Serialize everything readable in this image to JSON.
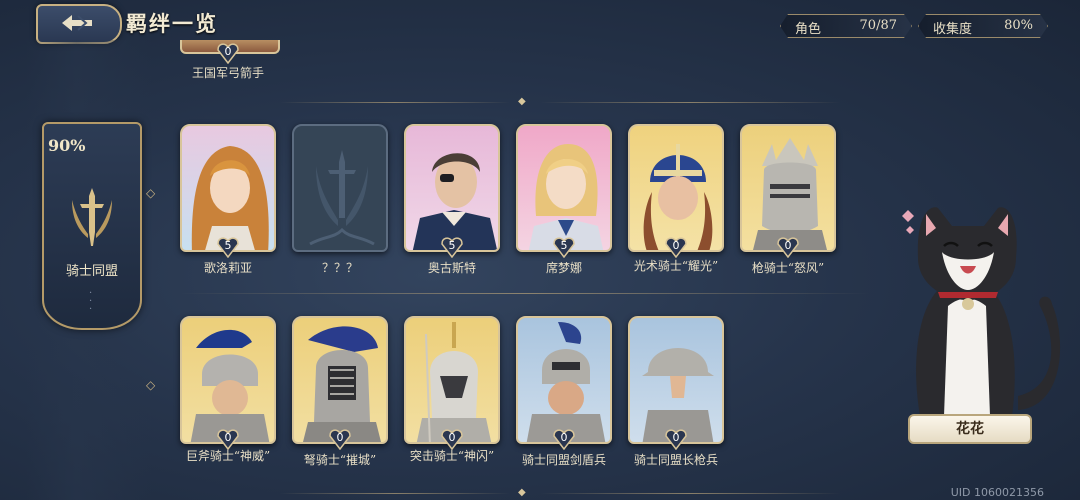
{
  "header": {
    "title": "羁绊一览"
  },
  "stats": {
    "roles_label": "角色",
    "roles_value": "70/87",
    "collection_label": "收集度",
    "collection_value": "80%"
  },
  "faction": {
    "percent": "90%",
    "name": "骑士同盟"
  },
  "top_row": [
    {
      "name": "王国军弓箭手",
      "level": "0"
    }
  ],
  "row1": [
    {
      "name": "歌洛莉亚",
      "level": "5"
    },
    {
      "name": "？？？",
      "level": ""
    },
    {
      "name": "奥古斯特",
      "level": "5"
    },
    {
      "name": "席梦娜",
      "level": "5"
    },
    {
      "name": "光术骑士“耀光”",
      "level": "0"
    },
    {
      "name": "枪骑士“怒风”",
      "level": "0"
    }
  ],
  "row2": [
    {
      "name": "巨斧骑士“神威”",
      "level": "0"
    },
    {
      "name": "弩骑士“摧城”",
      "level": "0"
    },
    {
      "name": "突击骑士“神闪”",
      "level": "0"
    },
    {
      "name": "骑士同盟剑盾兵",
      "level": "0"
    },
    {
      "name": "骑士同盟长枪兵",
      "level": "0"
    }
  ],
  "companion": {
    "name": "花花"
  },
  "uid": "UID 1060021356",
  "colors": {
    "gold": "#d8c59a",
    "bg": "#26344b"
  }
}
